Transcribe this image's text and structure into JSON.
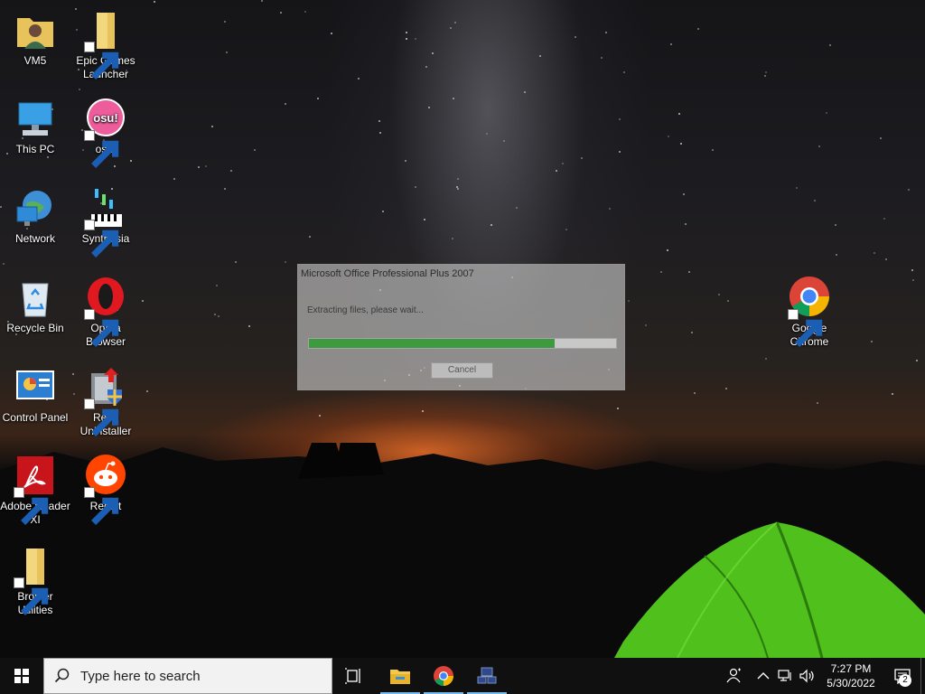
{
  "desktop_icons": [
    {
      "label": "VM5",
      "icon": "user-folder-icon"
    },
    {
      "label": "Epic Games Launcher",
      "icon": "folder-shortcut-icon"
    },
    {
      "label": "This PC",
      "icon": "computer-icon"
    },
    {
      "label": "osu!",
      "icon": "osu-icon"
    },
    {
      "label": "Network",
      "icon": "network-icon"
    },
    {
      "label": "Synthesia",
      "icon": "synthesia-icon"
    },
    {
      "label": "Recycle Bin",
      "icon": "recycle-bin-icon"
    },
    {
      "label": "Opera Browser",
      "icon": "opera-icon"
    },
    {
      "label": "Control Panel",
      "icon": "control-panel-icon"
    },
    {
      "label": "Revo Uninstaller",
      "icon": "revo-uninstaller-icon"
    },
    {
      "label": "Adobe Reader XI",
      "icon": "adobe-reader-icon"
    },
    {
      "label": "Reddit",
      "icon": "reddit-icon"
    },
    {
      "label": "Brother Utilities",
      "icon": "folder-shortcut-icon"
    },
    {
      "label": "Google Chrome",
      "icon": "chrome-icon"
    }
  ],
  "dialog": {
    "title": "Microsoft Office Professional Plus 2007",
    "message": "Extracting files, please wait...",
    "progress": 0.8,
    "cancel_label": "Cancel"
  },
  "taskbar": {
    "search_placeholder": "Type here to search",
    "pinned": [
      "task-view-icon",
      "file-explorer-icon",
      "chrome-icon",
      "network-app-icon"
    ],
    "clock_time": "7:27 PM",
    "clock_date": "5/30/2022",
    "notification_count": "2"
  },
  "colors": {
    "accent": "#76b9ed",
    "progress_fill": "#3e9a3e",
    "taskbar": "#101010"
  }
}
